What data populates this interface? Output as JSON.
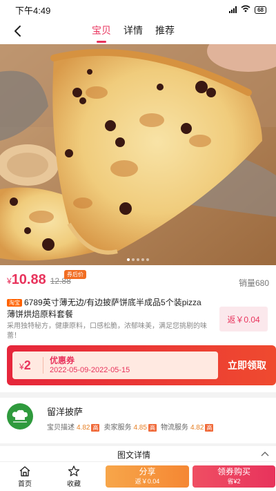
{
  "status": {
    "time": "下午4:49",
    "network": "4G",
    "battery": "68"
  },
  "nav": {
    "tabs": [
      {
        "label": "宝贝"
      },
      {
        "label": "详情"
      },
      {
        "label": "推荐"
      }
    ]
  },
  "product": {
    "currency": "¥",
    "price": "10.88",
    "after_coupon_badge": "券后价",
    "original_price": "12.88",
    "sales_label": "销量680",
    "platform_badge": "淘宝",
    "title": "6789英寸薄无边/有边披萨饼底半成品5个装pizza薄饼烘焙原料套餐",
    "description": "采用独特秘方，健康原料，口感松脆，浓郁味美，满足您挑剔的味蕾！",
    "rebate": "返￥0.04"
  },
  "coupon": {
    "currency": "¥",
    "amount": "2",
    "title": "优惠券",
    "dates": "2022-05-09-2022-05-15",
    "claim_label": "立即领取"
  },
  "shop": {
    "name": "留洋披萨",
    "scores": [
      {
        "label": "宝贝描述",
        "value": "4.82",
        "level": "高"
      },
      {
        "label": "卖家服务",
        "value": "4.85",
        "level": "高"
      },
      {
        "label": "物流服务",
        "value": "4.82",
        "level": "高"
      }
    ]
  },
  "detail": {
    "title": "图文详情"
  },
  "tabbar": {
    "home": "首页",
    "favorite": "收藏",
    "share_label": "分享",
    "share_sub": "返￥0.04",
    "buy_label": "领券购买",
    "buy_sub": "省¥2"
  },
  "colors": {
    "accent": "#e8335c",
    "coupon": "#e6263b",
    "share": "#f58733",
    "price": "#e8335c"
  }
}
